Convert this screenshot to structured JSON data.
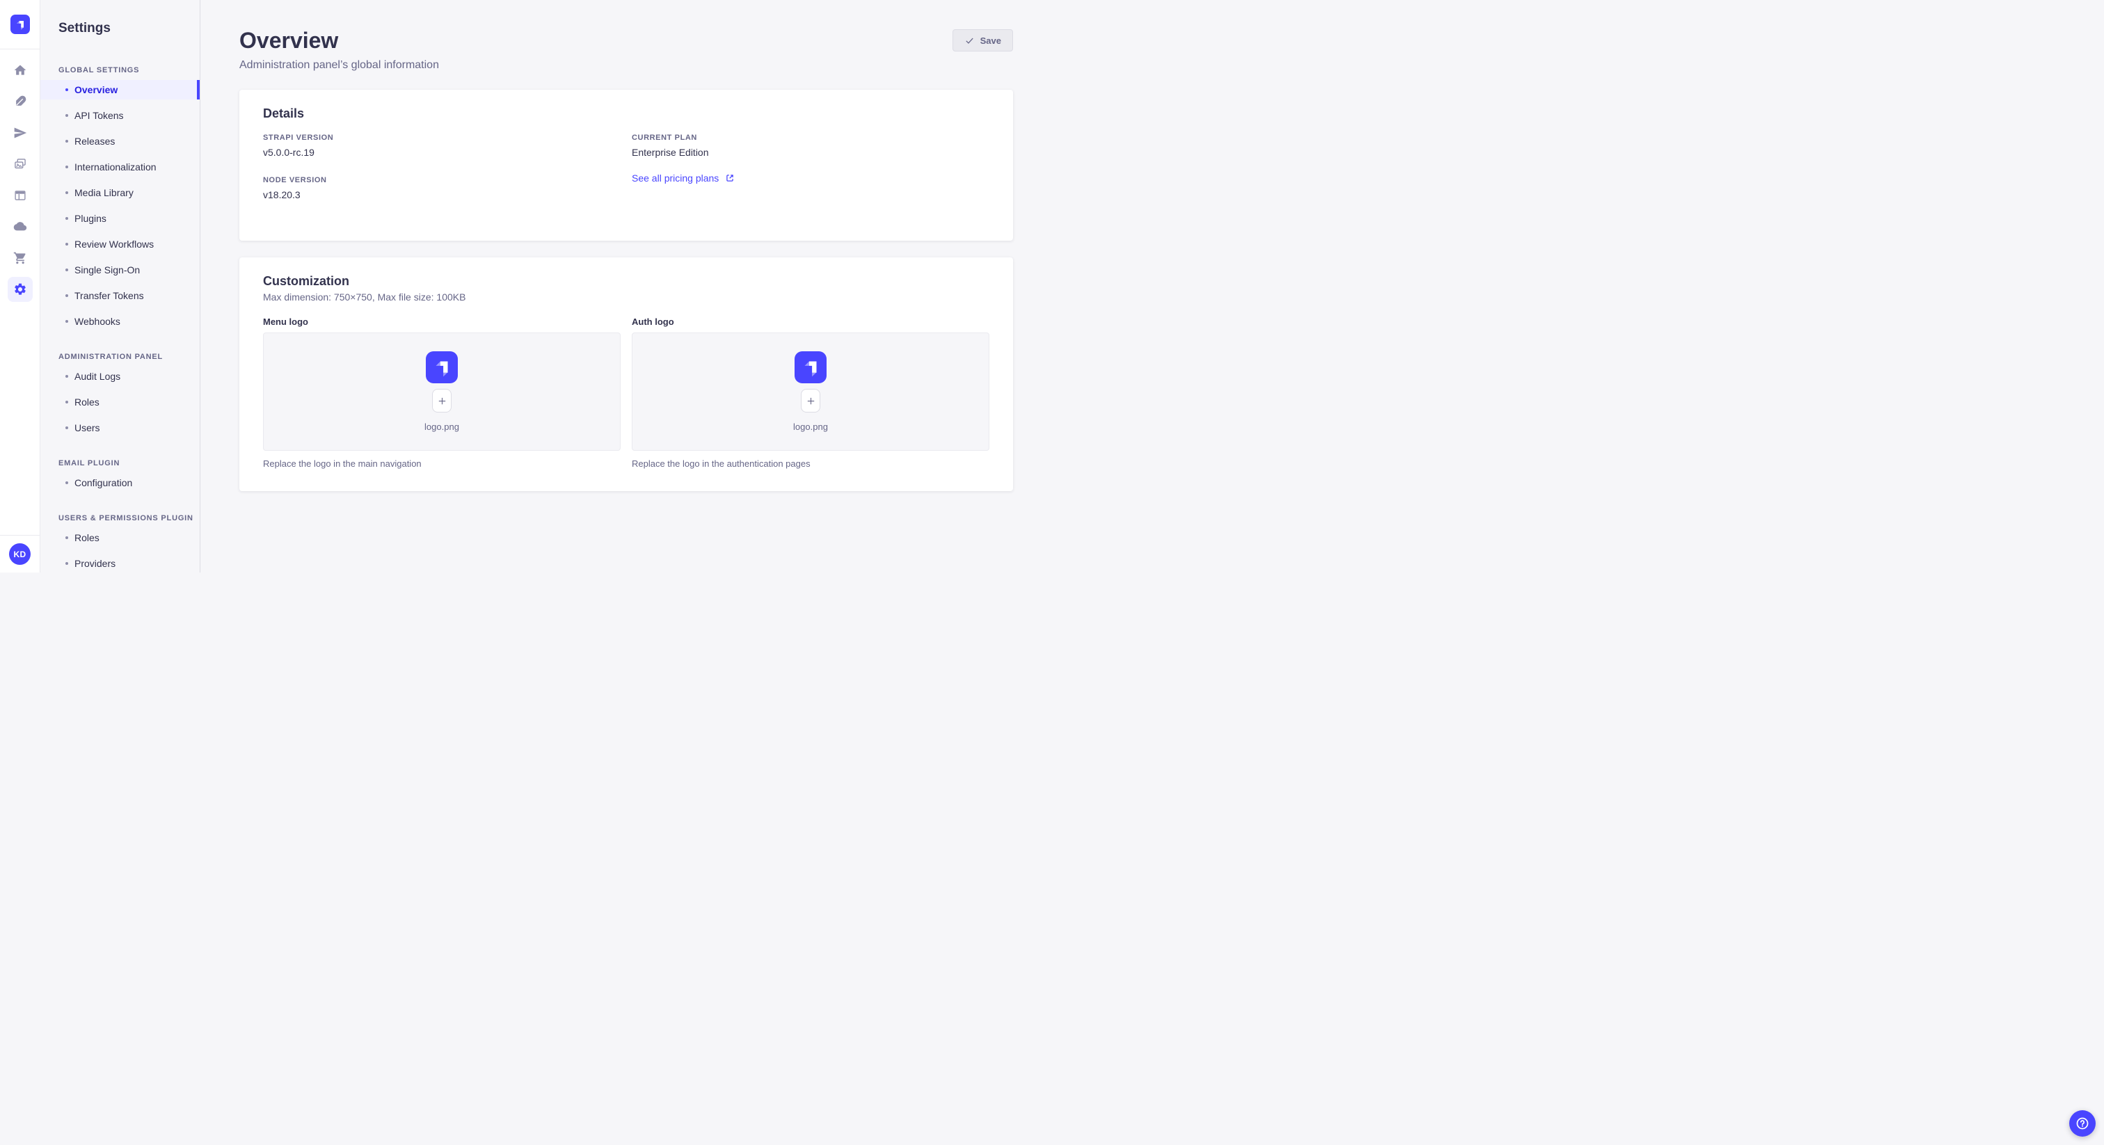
{
  "colors": {
    "primary": "#4945ff",
    "active_nav_bg": "#f0f0ff",
    "active_nav_text": "#271fe0",
    "page_bg": "#f6f6f9",
    "muted_text": "#666687",
    "dark_text": "#32324d"
  },
  "icon_rail": {
    "logo": "strapi-logo",
    "icons": [
      "home",
      "feather",
      "paper-plane",
      "media",
      "layout",
      "cloud",
      "cart",
      "settings-gear"
    ],
    "active_icon": "settings-gear"
  },
  "user": {
    "initials": "KD"
  },
  "subnav": {
    "title": "Settings",
    "sections": [
      {
        "label": "GLOBAL SETTINGS",
        "items": [
          {
            "label": "Overview",
            "active": true
          },
          {
            "label": "API Tokens"
          },
          {
            "label": "Releases"
          },
          {
            "label": "Internationalization"
          },
          {
            "label": "Media Library"
          },
          {
            "label": "Plugins"
          },
          {
            "label": "Review Workflows"
          },
          {
            "label": "Single Sign-On"
          },
          {
            "label": "Transfer Tokens"
          },
          {
            "label": "Webhooks"
          }
        ]
      },
      {
        "label": "ADMINISTRATION PANEL",
        "items": [
          {
            "label": "Audit Logs"
          },
          {
            "label": "Roles"
          },
          {
            "label": "Users"
          }
        ]
      },
      {
        "label": "EMAIL PLUGIN",
        "items": [
          {
            "label": "Configuration"
          }
        ]
      },
      {
        "label": "USERS & PERMISSIONS PLUGIN",
        "items": [
          {
            "label": "Roles"
          },
          {
            "label": "Providers"
          }
        ]
      }
    ]
  },
  "header": {
    "title": "Overview",
    "subtitle": "Administration panel’s global information",
    "save": "Save"
  },
  "details": {
    "title": "Details",
    "strapi_version": {
      "label": "STRAPI VERSION",
      "value": "v5.0.0-rc.19"
    },
    "node_version": {
      "label": "NODE VERSION",
      "value": "v18.20.3"
    },
    "current_plan": {
      "label": "CURRENT PLAN",
      "value": "Enterprise Edition"
    },
    "pricing_link": "See all pricing plans"
  },
  "customization": {
    "title": "Customization",
    "constraints": "Max dimension: 750×750, Max file size: 100KB",
    "menu_logo": {
      "label": "Menu logo",
      "filename": "logo.png",
      "hint": "Replace the logo in the main navigation"
    },
    "auth_logo": {
      "label": "Auth logo",
      "filename": "logo.png",
      "hint": "Replace the logo in the authentication pages"
    }
  }
}
